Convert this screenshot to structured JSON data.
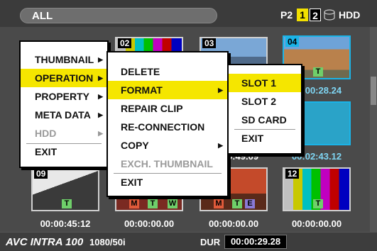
{
  "topbar": {
    "filter_label": "ALL",
    "p2_label": "P2",
    "slot1": "1",
    "slot2": "2",
    "hdd_label": "HDD"
  },
  "thumbs": [
    {
      "num": "02",
      "time": "",
      "icons": []
    },
    {
      "num": "03",
      "time": "",
      "icons": []
    },
    {
      "num": "04",
      "time": "00:00:28.24",
      "icons": [
        "T"
      ]
    },
    {
      "num": "",
      "time": "00:02:43.12",
      "icons": []
    },
    {
      "num": "",
      "time": "00:00:49.09",
      "icons": []
    },
    {
      "num": "09",
      "time": "00:00:45:12",
      "icons": [
        "T"
      ]
    },
    {
      "num": "",
      "time": "00:00:00.00",
      "icons": [
        "M",
        "T",
        "W"
      ]
    },
    {
      "num": "",
      "time": "00:00:00.00",
      "icons": [
        "M",
        "T",
        "E"
      ]
    },
    {
      "num": "12",
      "time": "00:00:00.00",
      "icons": [
        "T"
      ]
    }
  ],
  "menu_main": {
    "items": [
      "THUMBNAIL",
      "OPERATION",
      "PROPERTY",
      "META DATA",
      "HDD",
      "EXIT"
    ]
  },
  "menu_operation": {
    "items": [
      "DELETE",
      "FORMAT",
      "REPAIR CLIP",
      "RE-CONNECTION",
      "COPY",
      "EXCH. THUMBNAIL",
      "EXIT"
    ]
  },
  "menu_format": {
    "items": [
      "SLOT 1",
      "SLOT 2",
      "SD CARD",
      "EXIT"
    ]
  },
  "bottombar": {
    "codec_label": "AVC INTRA 100",
    "format": "1080/50i",
    "dur_label": "DUR",
    "dur_value": "00:00:29.28"
  },
  "colors": {
    "highlight": "#f5e600",
    "selected_border": "#1ab4e8"
  }
}
